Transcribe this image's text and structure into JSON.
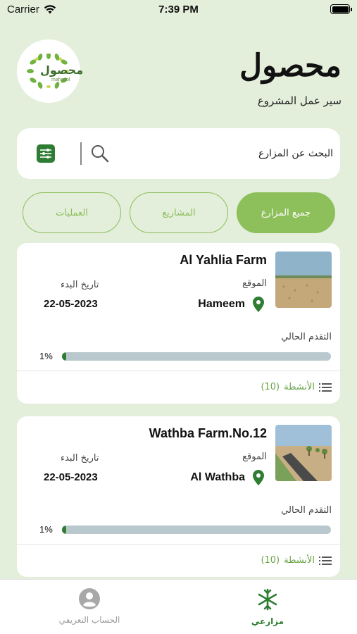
{
  "status_bar": {
    "carrier": "Carrier",
    "time": "7:39 PM"
  },
  "header": {
    "logo_text_ar": "محصول",
    "logo_text_en": "mahsool",
    "title": "محصول",
    "subtitle": "سير عمل المشروع"
  },
  "search": {
    "placeholder": "البحث عن المزارع"
  },
  "tabs": [
    {
      "label": "العمليات",
      "active": false
    },
    {
      "label": "المشاريع",
      "active": false
    },
    {
      "label": "جميع المزارع",
      "active": true
    }
  ],
  "farms": [
    {
      "name": "Al Yahlia Farm",
      "location_label": "الموقع",
      "location": "Hameem",
      "start_label": "تاريخ البدء",
      "start_date": "22-05-2023",
      "progress_label": "التقدم الحالي",
      "progress_text": "1%",
      "progress": 0.01,
      "activities_label": "الأنشطة",
      "activities_count": "(10)"
    },
    {
      "name": "Wathba Farm.No.12",
      "location_label": "الموقع",
      "location": "Al Wathba",
      "start_label": "تاريخ البدء",
      "start_date": "22-05-2023",
      "progress_label": "التقدم الحالي",
      "progress_text": "1%",
      "progress": 0.01,
      "activities_label": "الأنشطة",
      "activities_count": "(10)"
    }
  ],
  "bottom_nav": {
    "profile_label": "الحساب التعريفي",
    "farms_label": "مزارعي"
  },
  "colors": {
    "background": "#e3eedb",
    "accent_green": "#8dbf5a",
    "dark_green": "#2e7d32",
    "progress_track": "#b9c8cc"
  },
  "icons": [
    "wifi-icon",
    "battery-icon",
    "filter-icon",
    "search-icon",
    "location-pin-icon",
    "list-icon",
    "profile-icon",
    "farm-snowflake-icon"
  ]
}
